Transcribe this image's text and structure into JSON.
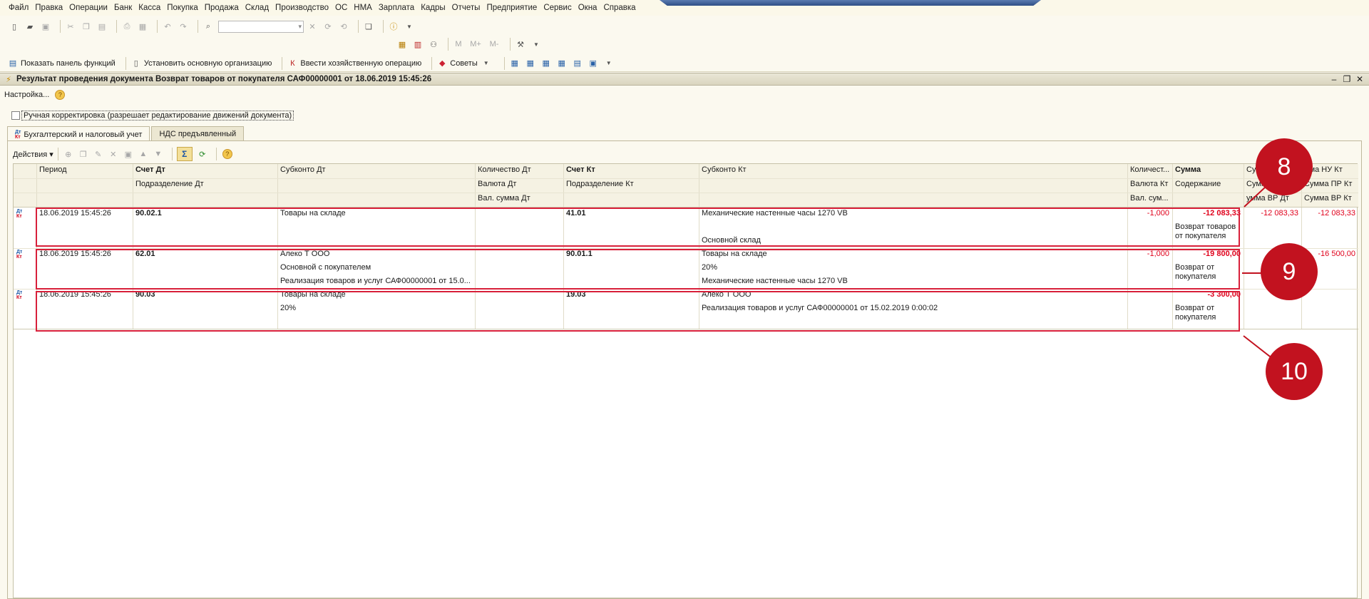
{
  "menu": [
    "Файл",
    "Правка",
    "Операции",
    "Банк",
    "Касса",
    "Покупка",
    "Продажа",
    "Склад",
    "Производство",
    "ОС",
    "НМА",
    "Зарплата",
    "Кадры",
    "Отчеты",
    "Предприятие",
    "Сервис",
    "Окна",
    "Справка"
  ],
  "toolbar3": {
    "show_panel": "Показать панель функций",
    "set_org": "Установить основную организацию",
    "enter_op": "Ввести хозяйственную операцию",
    "tips": "Советы"
  },
  "memory_labels": [
    "M",
    "M+",
    "M-"
  ],
  "window": {
    "title": "Результат проведения документа Возврат товаров от покупателя САФ00000001 от 18.06.2019 15:45:26",
    "settings": "Настройка...",
    "manual_correction": "Ручная корректировка (разрешает редактирование движений документа)"
  },
  "tabs": [
    "Бухгалтерский и налоговый учет",
    "НДС предъявленный"
  ],
  "actions_label": "Действия",
  "grid": {
    "headers_row1": [
      "Период",
      "Счет Дт",
      "Субконто Дт",
      "Количество Дт",
      "Счет Кт",
      "Субконто Кт",
      "Количест...",
      "Сумма",
      "Сумма НУ Дт",
      "Сумма НУ Кт"
    ],
    "headers_row2": [
      "",
      "Подразделение Дт",
      "",
      "Валюта Дт",
      "Подразделение Кт",
      "",
      "Валюта Кт",
      "Содержание",
      "Сумма ПР Дт",
      "Сумма ПР Кт"
    ],
    "headers_row3": [
      "",
      "",
      "",
      "Вал. сумма Дт",
      "",
      "",
      "Вал. сум...",
      "",
      "Сумма ВР Дт",
      "Сумма ВР Кт"
    ],
    "visible_header_fragments": {
      "nu_dt": "Су",
      "nu_kt": "мма НУ Кт",
      "pr_dt": "Сумм",
      "pr_kt": "Сумма ПР Кт",
      "vr_dt": "умма ВР Дт",
      "vr_kt": "Сумма ВР Кт"
    },
    "rows": [
      {
        "period": "18.06.2019 15:45:26",
        "acc_dt": "90.02.1",
        "sub_dt": [
          "Товары на складе",
          "",
          ""
        ],
        "acc_kt": "41.01",
        "sub_kt": [
          "Механические настенные часы 1270 VB",
          "",
          "Основной склад"
        ],
        "qty_kt": "-1,000",
        "sum": "-12 083,33",
        "content": [
          "Возврат товаров",
          "от покупателя"
        ],
        "nu_dt": "-12 083,33",
        "nu_kt": "-12 083,33"
      },
      {
        "period": "18.06.2019 15:45:26",
        "acc_dt": "62.01",
        "sub_dt": [
          "Алеко Т ООО",
          "Основной с покупателем",
          "Реализация товаров и услуг САФ00000001 от 15.0..."
        ],
        "acc_kt": "90.01.1",
        "sub_kt": [
          "Товары на складе",
          "20%",
          "Механические настенные часы 1270 VB"
        ],
        "qty_kt": "-1,000",
        "sum": "-19 800,00",
        "content": [
          "Возврат от",
          "покупателя"
        ],
        "nu_dt": "-1",
        "nu_kt": "-16 500,00"
      },
      {
        "period": "18.06.2019 15:45:26",
        "acc_dt": "90.03",
        "sub_dt": [
          "Товары на складе",
          "20%",
          ""
        ],
        "acc_kt": "19.03",
        "sub_kt": [
          "Алеко Т ООО",
          "Реализация товаров и услуг САФ00000001 от 15.02.2019 0:00:02",
          ""
        ],
        "qty_kt": "",
        "sum": "-3 300,00",
        "content": [
          "Возврат от",
          "покупателя"
        ],
        "nu_dt": "",
        "nu_kt": ""
      }
    ]
  },
  "callouts": [
    "8",
    "9",
    "10"
  ],
  "colors": {
    "accent_red": "#c2121f",
    "negative": "#e0001b"
  }
}
